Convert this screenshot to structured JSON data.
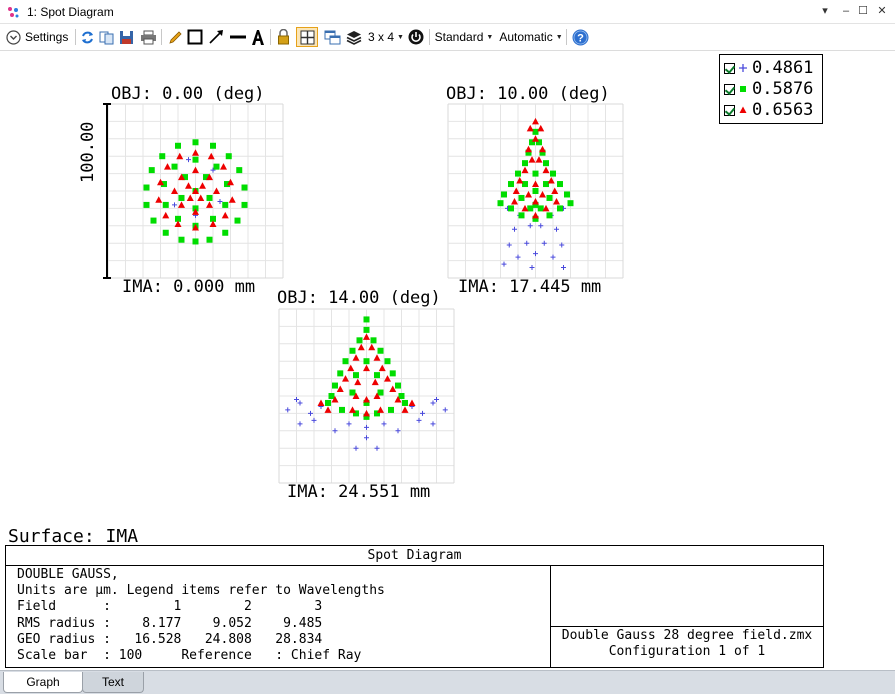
{
  "window": {
    "title": "1: Spot Diagram",
    "controls": {
      "menu": "▾",
      "minimize": "–",
      "maximize": "☐",
      "close": "✕"
    }
  },
  "toolbar": {
    "settings_label": "Settings",
    "layout_label": "3 x 4",
    "standard_label": "Standard",
    "automatic_label": "Automatic"
  },
  "legend": {
    "items": [
      {
        "label": "0.4861",
        "marker": "plus",
        "color": "#4a4adc"
      },
      {
        "label": "0.5876",
        "marker": "square",
        "color": "#00dd00"
      },
      {
        "label": "0.6563",
        "marker": "triangle",
        "color": "#ee0000"
      }
    ]
  },
  "chart_data": [
    {
      "type": "scatter",
      "title": "OBJ: 0.00 (deg)",
      "xlabel": "IMA: 0.000 mm",
      "ylabel": "100.00",
      "series": [
        {
          "name": "0.4861",
          "marker": "plus",
          "color": "#4a4adc",
          "points": [
            [
              -12,
              8
            ],
            [
              10,
              -12
            ],
            [
              -4,
              -18
            ],
            [
              14,
              6
            ],
            [
              0,
              14
            ]
          ]
        },
        {
          "name": "0.5876",
          "marker": "square",
          "color": "#00dd00",
          "points": [
            [
              0,
              -28
            ],
            [
              10,
              -26
            ],
            [
              -10,
              -26
            ],
            [
              19,
              -20
            ],
            [
              -19,
              -20
            ],
            [
              25,
              -12
            ],
            [
              -25,
              -12
            ],
            [
              28,
              -2
            ],
            [
              -28,
              -2
            ],
            [
              28,
              8
            ],
            [
              -28,
              8
            ],
            [
              24,
              17
            ],
            [
              -24,
              17
            ],
            [
              17,
              24
            ],
            [
              -17,
              24
            ],
            [
              8,
              28
            ],
            [
              -8,
              28
            ],
            [
              0,
              29
            ],
            [
              0,
              -18
            ],
            [
              12,
              -14
            ],
            [
              -12,
              -14
            ],
            [
              18,
              -4
            ],
            [
              -18,
              -4
            ],
            [
              17,
              8
            ],
            [
              -17,
              8
            ],
            [
              10,
              16
            ],
            [
              -10,
              16
            ],
            [
              0,
              20
            ],
            [
              6,
              -8
            ],
            [
              -6,
              -8
            ],
            [
              8,
              4
            ],
            [
              -8,
              4
            ],
            [
              0,
              10
            ],
            [
              0,
              0
            ]
          ]
        },
        {
          "name": "0.6563",
          "marker": "triangle",
          "color": "#ee0000",
          "points": [
            [
              0,
              -22
            ],
            [
              9,
              -20
            ],
            [
              -9,
              -20
            ],
            [
              16,
              -14
            ],
            [
              -16,
              -14
            ],
            [
              20,
              -5
            ],
            [
              -20,
              -5
            ],
            [
              21,
              5
            ],
            [
              -21,
              5
            ],
            [
              17,
              14
            ],
            [
              -17,
              14
            ],
            [
              10,
              19
            ],
            [
              -10,
              19
            ],
            [
              0,
              21
            ],
            [
              0,
              -12
            ],
            [
              8,
              -8
            ],
            [
              -8,
              -8
            ],
            [
              12,
              0
            ],
            [
              -12,
              0
            ],
            [
              8,
              8
            ],
            [
              -8,
              8
            ],
            [
              0,
              12
            ],
            [
              4,
              -3
            ],
            [
              -4,
              -3
            ],
            [
              3,
              4
            ],
            [
              -3,
              4
            ],
            [
              0,
              0
            ]
          ]
        }
      ]
    },
    {
      "type": "scatter",
      "title": "OBJ: 10.00 (deg)",
      "xlabel": "IMA: 17.445 mm",
      "series": [
        {
          "name": "0.4861",
          "marker": "plus",
          "color": "#4a4adc",
          "points": [
            [
              -16,
              10
            ],
            [
              16,
              10
            ],
            [
              -9,
              14
            ],
            [
              9,
              14
            ],
            [
              -3,
              20
            ],
            [
              3,
              20
            ],
            [
              -15,
              31
            ],
            [
              -5,
              30
            ],
            [
              5,
              30
            ],
            [
              15,
              31
            ],
            [
              -10,
              38
            ],
            [
              0,
              36
            ],
            [
              10,
              38
            ],
            [
              -18,
              42
            ],
            [
              -2,
              44
            ],
            [
              16,
              44
            ],
            [
              -12,
              22
            ],
            [
              12,
              22
            ],
            [
              0,
              16
            ]
          ]
        },
        {
          "name": "0.5876",
          "marker": "square",
          "color": "#00dd00",
          "points": [
            [
              0,
              -34
            ],
            [
              2,
              -28
            ],
            [
              -2,
              -28
            ],
            [
              4,
              -22
            ],
            [
              -4,
              -22
            ],
            [
              6,
              -16
            ],
            [
              -6,
              -16
            ],
            [
              10,
              -10
            ],
            [
              -10,
              -10
            ],
            [
              14,
              -4
            ],
            [
              -14,
              -4
            ],
            [
              18,
              2
            ],
            [
              -18,
              2
            ],
            [
              20,
              7
            ],
            [
              -20,
              7
            ],
            [
              14,
              10
            ],
            [
              -14,
              10
            ],
            [
              8,
              14
            ],
            [
              -8,
              14
            ],
            [
              0,
              16
            ],
            [
              0,
              -10
            ],
            [
              6,
              -4
            ],
            [
              -6,
              -4
            ],
            [
              8,
              4
            ],
            [
              -8,
              4
            ],
            [
              0,
              8
            ],
            [
              0,
              0
            ],
            [
              3,
              10
            ],
            [
              -3,
              10
            ]
          ]
        },
        {
          "name": "0.6563",
          "marker": "triangle",
          "color": "#ee0000",
          "points": [
            [
              0,
              -40
            ],
            [
              3,
              -36
            ],
            [
              -3,
              -36
            ],
            [
              0,
              -30
            ],
            [
              4,
              -24
            ],
            [
              -4,
              -24
            ],
            [
              2,
              -18
            ],
            [
              -2,
              -18
            ],
            [
              6,
              -12
            ],
            [
              -6,
              -12
            ],
            [
              9,
              -6
            ],
            [
              -9,
              -6
            ],
            [
              11,
              0
            ],
            [
              -11,
              0
            ],
            [
              12,
              6
            ],
            [
              -12,
              6
            ],
            [
              6,
              10
            ],
            [
              -6,
              10
            ],
            [
              0,
              14
            ],
            [
              0,
              -4
            ],
            [
              4,
              2
            ],
            [
              -4,
              2
            ],
            [
              0,
              6
            ]
          ]
        }
      ]
    },
    {
      "type": "scatter",
      "title": "OBJ: 14.00 (deg)",
      "xlabel": "IMA: 24.551 mm",
      "series": [
        {
          "name": "0.4861",
          "marker": "plus",
          "color": "#4a4adc",
          "points": [
            [
              -45,
              8
            ],
            [
              -38,
              4
            ],
            [
              -32,
              10
            ],
            [
              -26,
              6
            ],
            [
              -30,
              14
            ],
            [
              -38,
              16
            ],
            [
              45,
              8
            ],
            [
              38,
              4
            ],
            [
              32,
              10
            ],
            [
              26,
              6
            ],
            [
              30,
              14
            ],
            [
              38,
              16
            ],
            [
              -40,
              2
            ],
            [
              40,
              2
            ],
            [
              -10,
              16
            ],
            [
              0,
              18
            ],
            [
              10,
              16
            ],
            [
              -6,
              30
            ],
            [
              6,
              30
            ],
            [
              -18,
              20
            ],
            [
              18,
              20
            ],
            [
              0,
              24
            ]
          ]
        },
        {
          "name": "0.5876",
          "marker": "square",
          "color": "#00dd00",
          "points": [
            [
              0,
              -44
            ],
            [
              0,
              -38
            ],
            [
              4,
              -32
            ],
            [
              -4,
              -32
            ],
            [
              8,
              -26
            ],
            [
              -8,
              -26
            ],
            [
              12,
              -20
            ],
            [
              -12,
              -20
            ],
            [
              15,
              -13
            ],
            [
              -15,
              -13
            ],
            [
              18,
              -6
            ],
            [
              -18,
              -6
            ],
            [
              20,
              0
            ],
            [
              -20,
              0
            ],
            [
              22,
              4
            ],
            [
              -22,
              4
            ],
            [
              14,
              8
            ],
            [
              -14,
              8
            ],
            [
              6,
              10
            ],
            [
              -6,
              10
            ],
            [
              0,
              12
            ],
            [
              0,
              -20
            ],
            [
              6,
              -12
            ],
            [
              -6,
              -12
            ],
            [
              8,
              -2
            ],
            [
              -8,
              -2
            ],
            [
              0,
              4
            ]
          ]
        },
        {
          "name": "0.6563",
          "marker": "triangle",
          "color": "#ee0000",
          "points": [
            [
              0,
              -34
            ],
            [
              3,
              -28
            ],
            [
              -3,
              -28
            ],
            [
              6,
              -22
            ],
            [
              -6,
              -22
            ],
            [
              9,
              -16
            ],
            [
              -9,
              -16
            ],
            [
              12,
              -10
            ],
            [
              -12,
              -10
            ],
            [
              15,
              -4
            ],
            [
              -15,
              -4
            ],
            [
              18,
              2
            ],
            [
              -18,
              2
            ],
            [
              26,
              4
            ],
            [
              -26,
              4
            ],
            [
              22,
              8
            ],
            [
              -22,
              8
            ],
            [
              8,
              8
            ],
            [
              -8,
              8
            ],
            [
              0,
              10
            ],
            [
              0,
              -16
            ],
            [
              5,
              -8
            ],
            [
              -5,
              -8
            ],
            [
              6,
              0
            ],
            [
              -6,
              0
            ],
            [
              0,
              2
            ]
          ]
        }
      ]
    }
  ],
  "surface_label": "Surface: IMA",
  "info": {
    "heading": "Spot Diagram",
    "lines": [
      "DOUBLE GAUSS,",
      "Units are µm. Legend items refer to Wavelengths",
      "Field      :        1        2        3",
      "RMS radius :    8.177    9.052    9.485",
      "GEO radius :   16.528   24.808   28.834",
      "Scale bar  : 100     Reference   : Chief Ray"
    ],
    "file_line": "Double Gauss 28 degree field.zmx",
    "config_line": "Configuration 1 of 1"
  },
  "tabs": {
    "graph": "Graph",
    "text": "Text"
  }
}
